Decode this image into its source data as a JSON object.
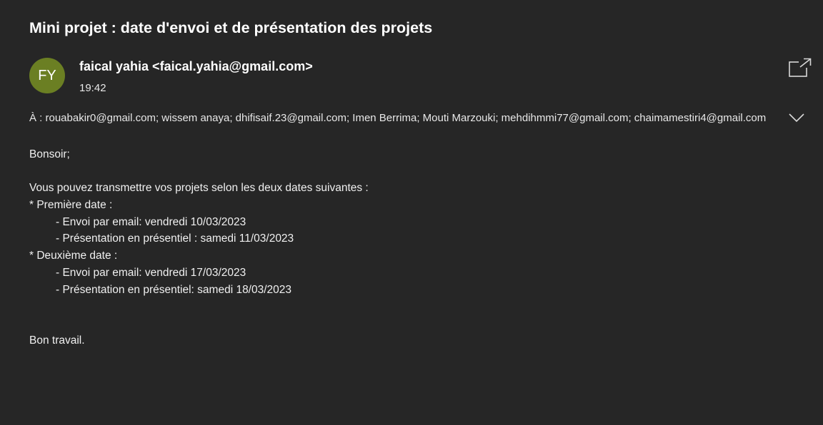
{
  "email": {
    "subject": "Mini projet : date d'envoi et de présentation des projets",
    "avatar_initials": "FY",
    "avatar_color": "#6b7f23",
    "sender": "faical yahia <faical.yahia@gmail.com>",
    "time": "19:42",
    "recipients": "À : rouabakir0@gmail.com; wissem anaya; dhifisaif.23@gmail.com; Imen Berrima; Mouti Marzouki; mehdihmmi77@gmail.com; chaimamestiri4@gmail.com",
    "popout_icon": "popout-icon",
    "expand_icon": "chevron-down-icon",
    "body": {
      "greeting": "Bonsoir;",
      "intro": "Vous pouvez transmettre vos projets selon les deux dates suivantes :",
      "first_date": "* Première date :",
      "first_send": "- Envoi par email: vendredi 10/03/2023",
      "first_presentation": "- Présentation en présentiel : samedi 11/03/2023",
      "second_date": "* Deuxième date :",
      "second_send": "- Envoi par email: vendredi 17/03/2023",
      "second_presentation": "- Présentation en présentiel: samedi 18/03/2023",
      "closing": "Bon travail."
    }
  }
}
